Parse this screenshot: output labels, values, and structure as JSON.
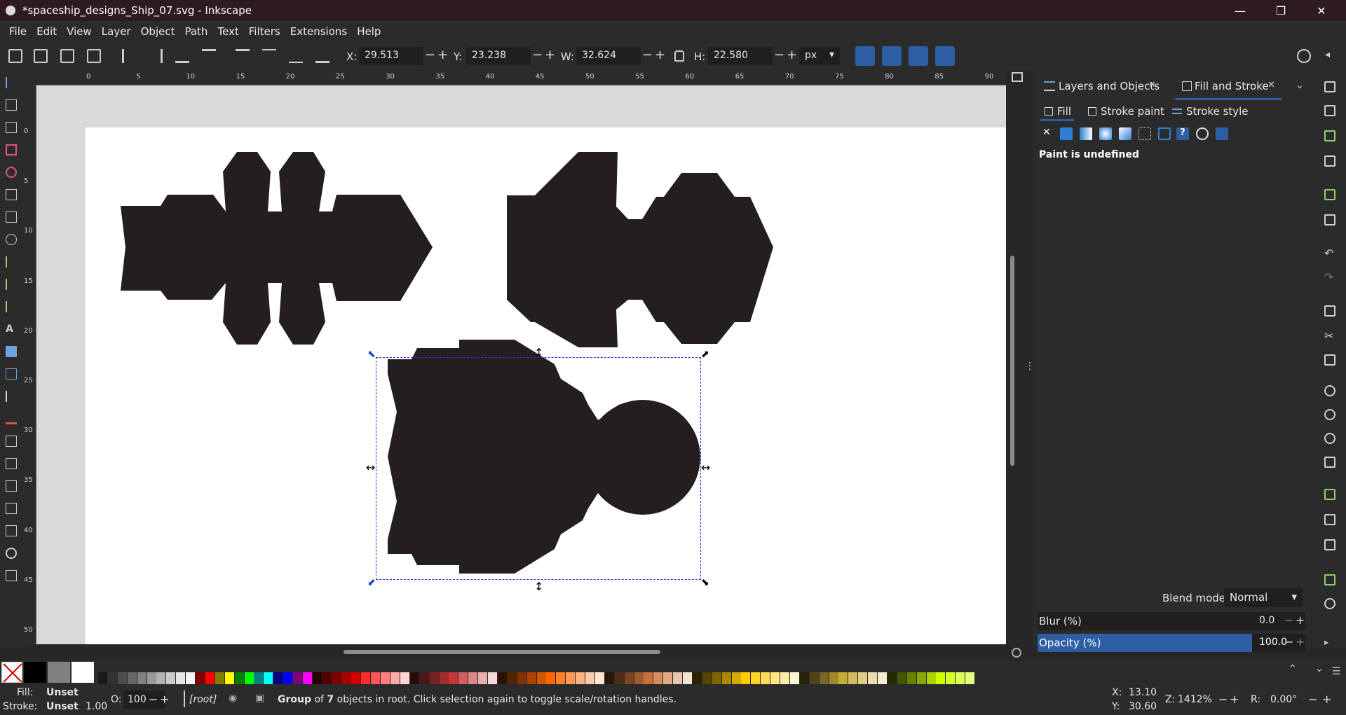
{
  "window": {
    "title": "*spaceship_designs_Ship_07.svg - Inkscape"
  },
  "menu": [
    "File",
    "Edit",
    "View",
    "Layer",
    "Object",
    "Path",
    "Text",
    "Filters",
    "Extensions",
    "Help"
  ],
  "toolbar": {
    "x_label": "X:",
    "x_value": "29.513",
    "y_label": "Y:",
    "y_value": "23.238",
    "w_label": "W:",
    "w_value": "32.624",
    "h_label": "H:",
    "h_value": "22.580",
    "unit": "px"
  },
  "ruler": {
    "h_ticks": [
      "0",
      "5",
      "10",
      "15",
      "20",
      "25",
      "30",
      "35",
      "40",
      "45",
      "50",
      "55",
      "60",
      "65",
      "70",
      "75",
      "80",
      "85",
      "90"
    ],
    "v_ticks": [
      "0",
      "5",
      "10",
      "15",
      "20",
      "25",
      "30",
      "35",
      "40",
      "45",
      "50"
    ]
  },
  "panel": {
    "tabs": [
      "Layers and Objects",
      "Fill and Stroke"
    ],
    "subtabs": [
      "Fill",
      "Stroke paint",
      "Stroke style"
    ],
    "paint_status": "Paint is undefined",
    "blend_label": "Blend mode:",
    "blend_value": "Normal",
    "blur_label": "Blur (%)",
    "blur_value": "0.0",
    "opacity_label": "Opacity (%)",
    "opacity_value": "100.0"
  },
  "status": {
    "fill_label": "Fill:",
    "fill_value": "Unset",
    "stroke_label": "Stroke:",
    "stroke_value": "Unset",
    "stroke_width": "1.00",
    "opacity_label": "O:",
    "opacity_value": "100",
    "layer": "[root]",
    "message_bold": "Group",
    "message_of": " of ",
    "message_count": "7",
    "message_rest": " objects in root. Click selection again to toggle scale/rotation handles.",
    "cursor_x_label": "X:",
    "cursor_x": "13.10",
    "cursor_y_label": "Y:",
    "cursor_y": "30.60",
    "zoom_label": "Z:",
    "zoom": "1412%",
    "rotate_label": "R:",
    "rotate": "0.00°"
  },
  "colors": {
    "accent": "#2d5ea3",
    "shape_fill": "#231f20",
    "selection": "#3333cc"
  }
}
